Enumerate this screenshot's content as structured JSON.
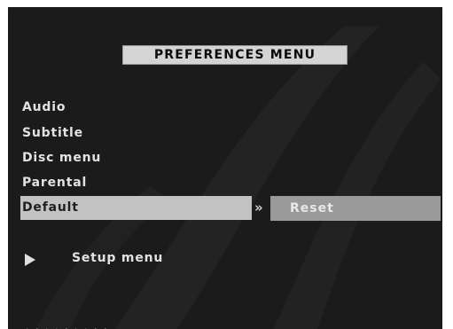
{
  "menu": {
    "title": "PREFERENCES MENU",
    "items": [
      {
        "label": "Audio"
      },
      {
        "label": "Subtitle"
      },
      {
        "label": "Disc menu"
      },
      {
        "label": "Parental"
      },
      {
        "label": "Default"
      }
    ],
    "selected_index": 4,
    "submenu_arrow": "»",
    "submenu_value": "Reset",
    "setup_label": "Setup menu"
  },
  "footer": {
    "text": ". , . . , . . , ,"
  },
  "icons": {
    "setup_arrow": "play-triangle-icon",
    "submenu": "double-chevron-right-icon"
  },
  "colors": {
    "background": "#1b1b1b",
    "title_bar": "#d4d4d4",
    "highlight": "#c2c2c2",
    "reset_bar": "#9a9a9a",
    "text": "#e2e2e2"
  }
}
